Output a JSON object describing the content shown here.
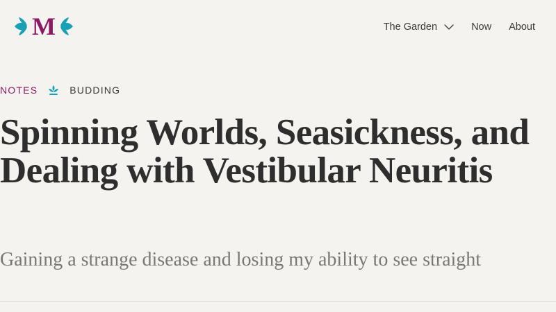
{
  "brand": {
    "logo_letter": "M",
    "accent_color": "#8a1b63",
    "leaf_color": "#1aa0b4",
    "icon": "leaf-monogram-logo"
  },
  "nav": {
    "items": [
      {
        "label": "The Garden",
        "has_dropdown": true
      },
      {
        "label": "Now"
      },
      {
        "label": "About"
      }
    ]
  },
  "meta": {
    "category": "NOTES",
    "stage_icon": "sprout-icon",
    "stage": "BUDDING"
  },
  "article": {
    "title": "Spinning Worlds, Seasickness, and Dealing with Vestibular Neuritis",
    "subtitle": "Gaining a strange disease and losing my ability to see straight"
  }
}
